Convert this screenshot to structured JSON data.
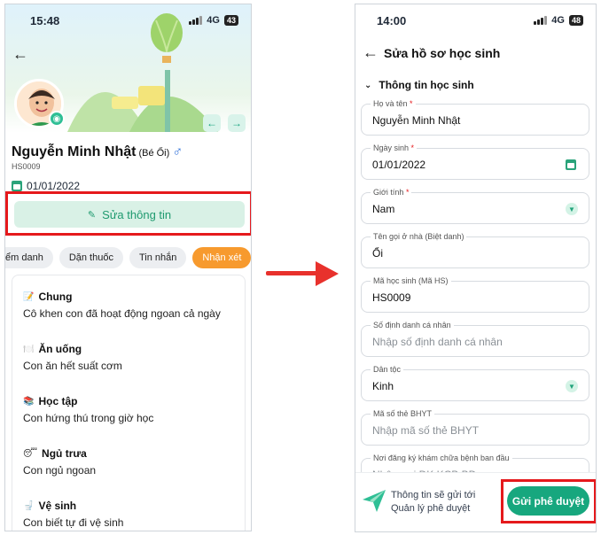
{
  "left": {
    "status_time": "15:48",
    "network": "4G",
    "battery": "43",
    "student_name": "Nguyễn Minh Nhật",
    "nickname": "(Bé Ổi)",
    "student_code": "HS0009",
    "birth_date": "01/01/2022",
    "edit_button": "Sửa thông tin",
    "tabs": [
      "ểm danh",
      "Dặn thuốc",
      "Tin nhắn",
      "Nhận xét"
    ],
    "comments": [
      {
        "icon": "📝",
        "title": "Chung",
        "text": "Cô khen con đã hoạt động ngoan cả ngày"
      },
      {
        "icon": "🍽️",
        "title": "Ăn uống",
        "text": "Con ăn hết suất cơm"
      },
      {
        "icon": "📚",
        "title": "Học tập",
        "text": "Con hứng thú trong giờ học"
      },
      {
        "icon": "😴",
        "title": "Ngủ trưa",
        "text": "Con ngủ ngoan"
      },
      {
        "icon": "🚽",
        "title": "Vệ sinh",
        "text": "Con biết tự đi vệ sinh"
      }
    ]
  },
  "right": {
    "status_time": "14:00",
    "network": "4G",
    "battery": "48",
    "title": "Sửa hồ sơ học sinh",
    "section": "Thông tin học sinh",
    "fields": [
      {
        "label": "Họ và tên",
        "required": "*",
        "value": "Nguyễn Minh Nhật"
      },
      {
        "label": "Ngày sinh",
        "required": "*",
        "value": "01/01/2022"
      },
      {
        "label": "Giới tính",
        "required": "*",
        "value": "Nam"
      },
      {
        "label": "Tên gọi ở nhà (Biệt danh)",
        "required": "",
        "value": "Ổi"
      },
      {
        "label": "Mã học sinh (Mã HS)",
        "required": "",
        "value": "HS0009"
      },
      {
        "label": "Số định danh cá nhân",
        "required": "",
        "placeholder": "Nhập số định danh cá nhân"
      },
      {
        "label": "Dân tộc",
        "required": "",
        "value": "Kinh"
      },
      {
        "label": "Mã số thẻ BHYT",
        "required": "",
        "placeholder": "Nhập mã số thẻ BHYT"
      },
      {
        "label": "Nơi đăng ký khám chữa bệnh ban đầu",
        "required": "",
        "placeholder": "Nhập nơi ĐK KCB BĐ"
      }
    ],
    "footer_line1": "Thông tin sẽ gửi tới",
    "footer_line2": "Quản lý phê duyệt",
    "submit_button": "Gửi phê duyệt"
  },
  "colors": {
    "accent": "#17a77e",
    "highlight": "#e5191c",
    "active_tab": "#f79a2e"
  }
}
